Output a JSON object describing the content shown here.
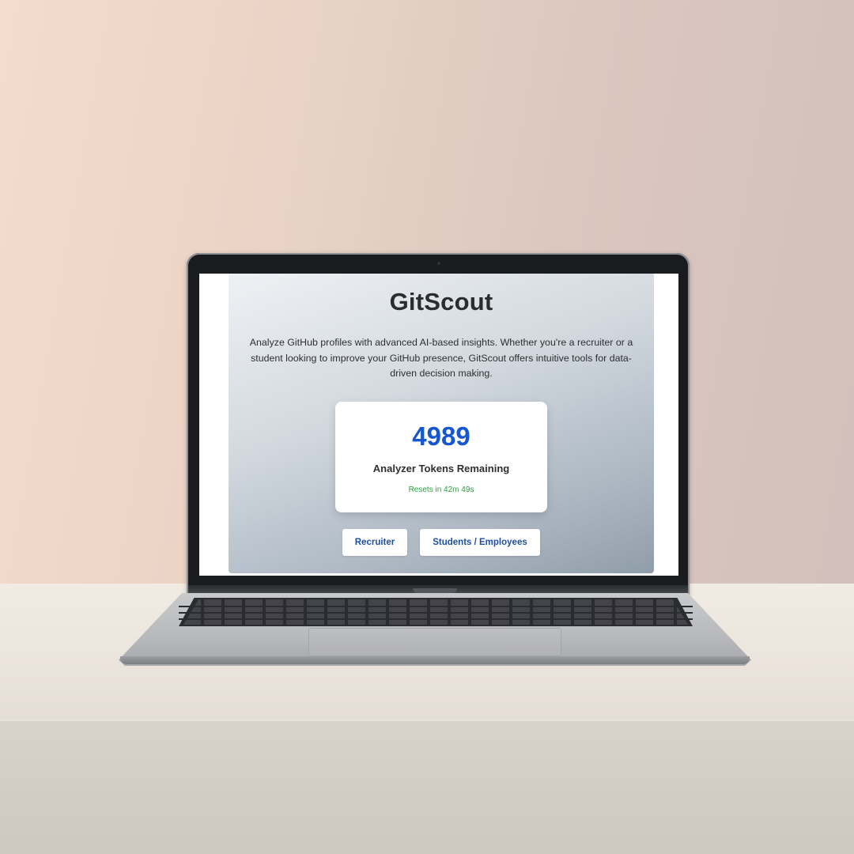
{
  "app": {
    "title": "GitScout",
    "description": "Analyze GitHub profiles with advanced AI-based insights. Whether you're a recruiter or a student looking to improve your GitHub presence, GitScout offers intuitive tools for data-driven decision making."
  },
  "tokens": {
    "count": "4989",
    "label": "Analyzer Tokens Remaining",
    "reset": "Resets in 42m 49s"
  },
  "buttons": {
    "recruiter": "Recruiter",
    "students": "Students / Employees"
  },
  "colors": {
    "accent": "#1556d1",
    "reset_text": "#2aa33e",
    "button_text": "#1f4fa3"
  }
}
